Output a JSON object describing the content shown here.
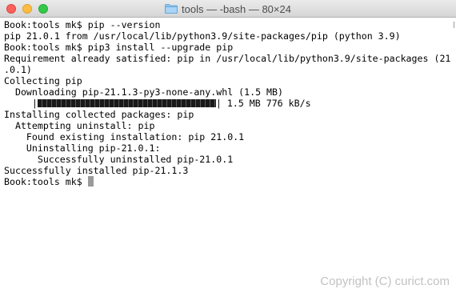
{
  "window": {
    "title": "tools — -bash — 80×24",
    "folder_icon": "folder-icon"
  },
  "terminal": {
    "lines": [
      "Book:tools mk$ pip --version",
      "pip 21.0.1 from /usr/local/lib/python3.9/site-packages/pip (python 3.9)",
      "Book:tools mk$ pip3 install --upgrade pip",
      "Requirement already satisfied: pip in /usr/local/lib/python3.9/site-packages (21",
      ".0.1)",
      "Collecting pip",
      "  Downloading pip-21.1.3-py3-none-any.whl (1.5 MB)",
      "Installing collected packages: pip",
      "  Attempting uninstall: pip",
      "    Found existing installation: pip 21.0.1",
      "    Uninstalling pip-21.0.1:",
      "      Successfully uninstalled pip-21.0.1",
      "Successfully installed pip-21.1.3",
      "Book:tools mk$ "
    ],
    "progress": {
      "indent": "     ",
      "open": "|",
      "close": "|",
      "fraction": 1.0,
      "stats": " 1.5 MB 776 kB/s"
    }
  },
  "watermark": "Copyright (C) curict.com"
}
